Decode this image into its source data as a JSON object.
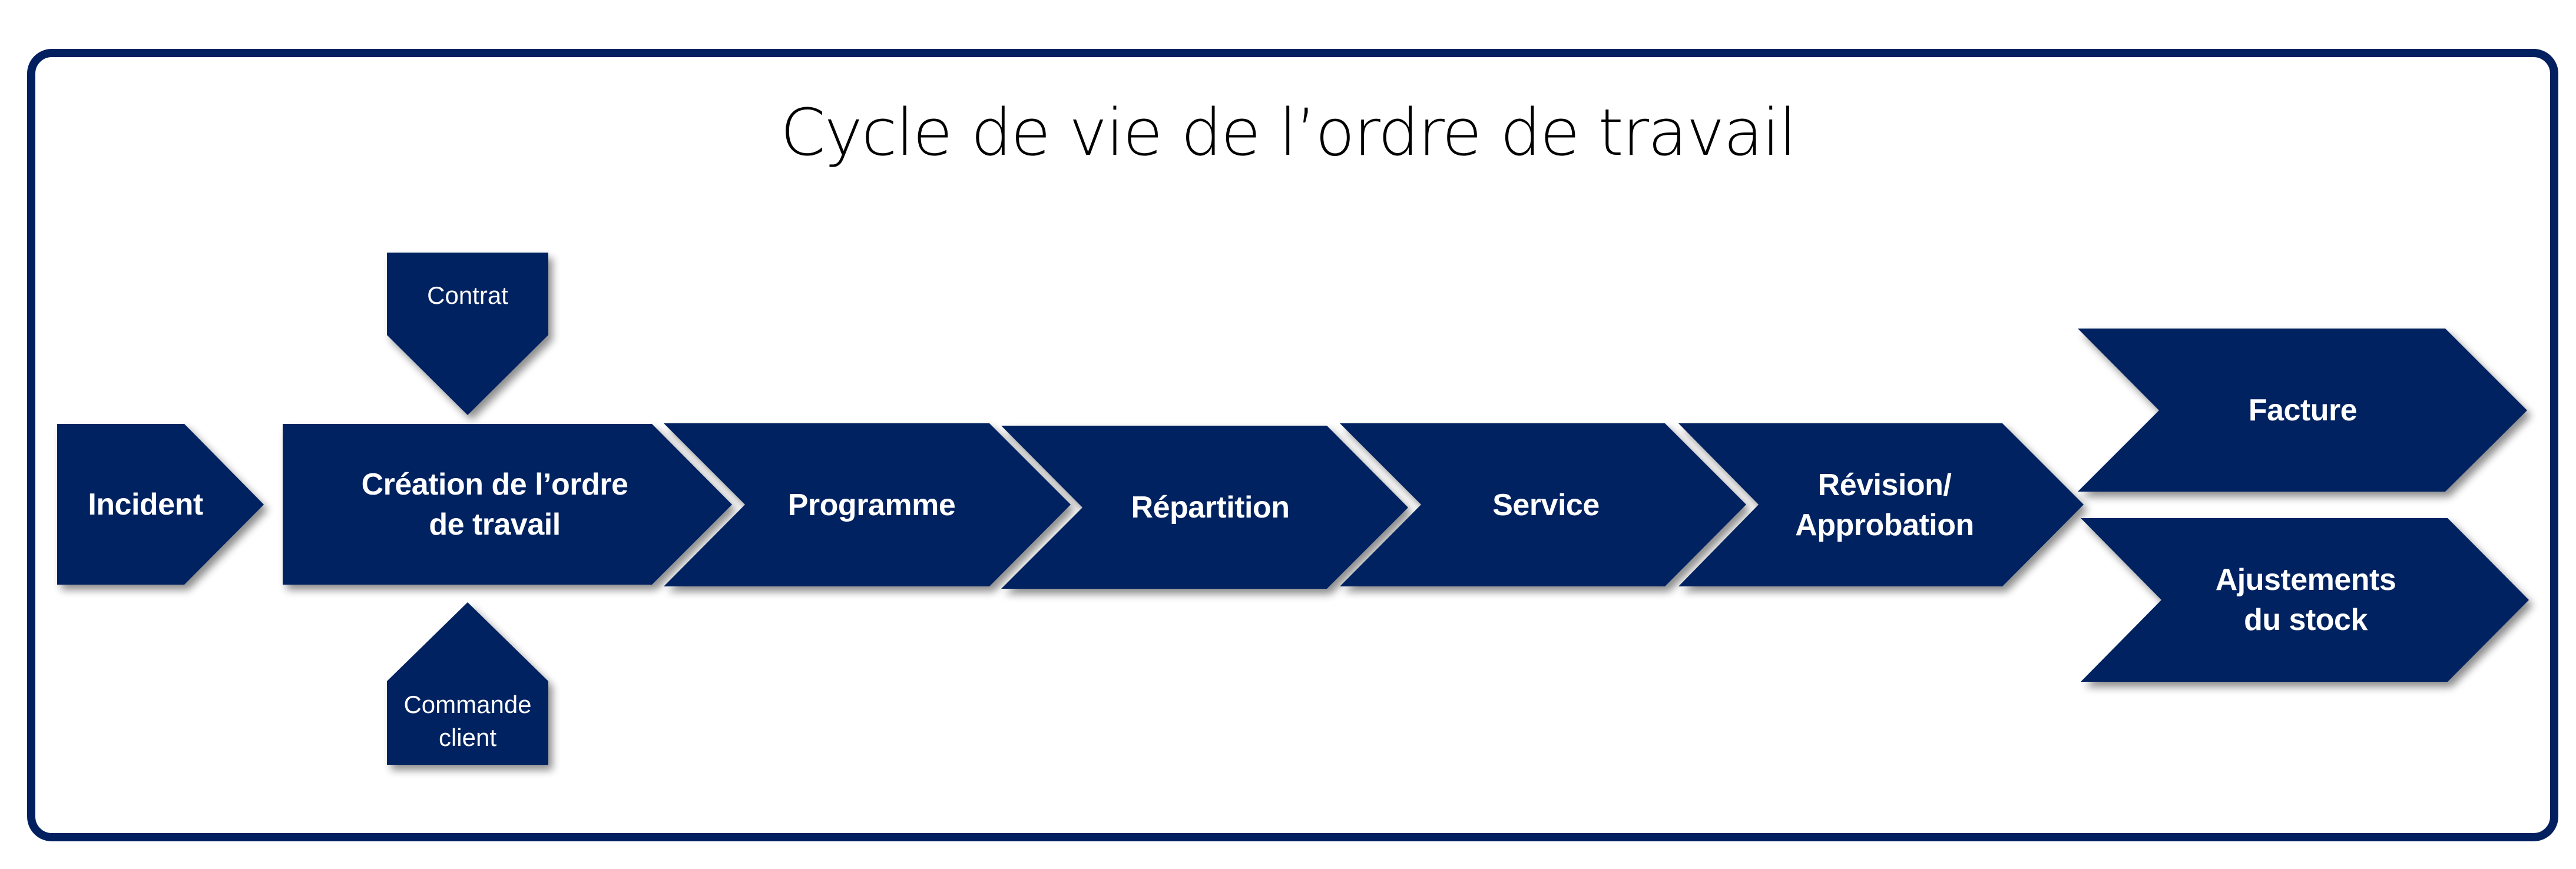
{
  "title": "Cycle de vie de l’ordre de travail",
  "colors": {
    "shape_fill": "#022060",
    "frame_border": "#022060",
    "text_on_shape": "#ffffff",
    "title_text": "#000000",
    "background": "#ffffff"
  },
  "diagram": {
    "type": "process-flow",
    "inputs": [
      {
        "id": "contrat",
        "label": "Contrat",
        "direction": "down",
        "feeds": "creation"
      },
      {
        "id": "commande",
        "label": "Commande\nclient",
        "direction": "up",
        "feeds": "creation"
      }
    ],
    "steps": [
      {
        "id": "incident",
        "label": "Incident"
      },
      {
        "id": "creation",
        "label": "Création de l’ordre\nde travail"
      },
      {
        "id": "programme",
        "label": "Programme"
      },
      {
        "id": "repartition",
        "label": "Répartition"
      },
      {
        "id": "service",
        "label": "Service"
      },
      {
        "id": "revision",
        "label": "Révision/\nApprobation"
      }
    ],
    "outcomes": [
      {
        "id": "facture",
        "label": "Facture"
      },
      {
        "id": "ajustements",
        "label": "Ajustements\ndu stock"
      }
    ],
    "edges": [
      [
        "contrat",
        "creation"
      ],
      [
        "commande",
        "creation"
      ],
      [
        "incident",
        "creation"
      ],
      [
        "creation",
        "programme"
      ],
      [
        "programme",
        "repartition"
      ],
      [
        "repartition",
        "service"
      ],
      [
        "service",
        "revision"
      ],
      [
        "revision",
        "facture"
      ],
      [
        "revision",
        "ajustements"
      ]
    ]
  }
}
